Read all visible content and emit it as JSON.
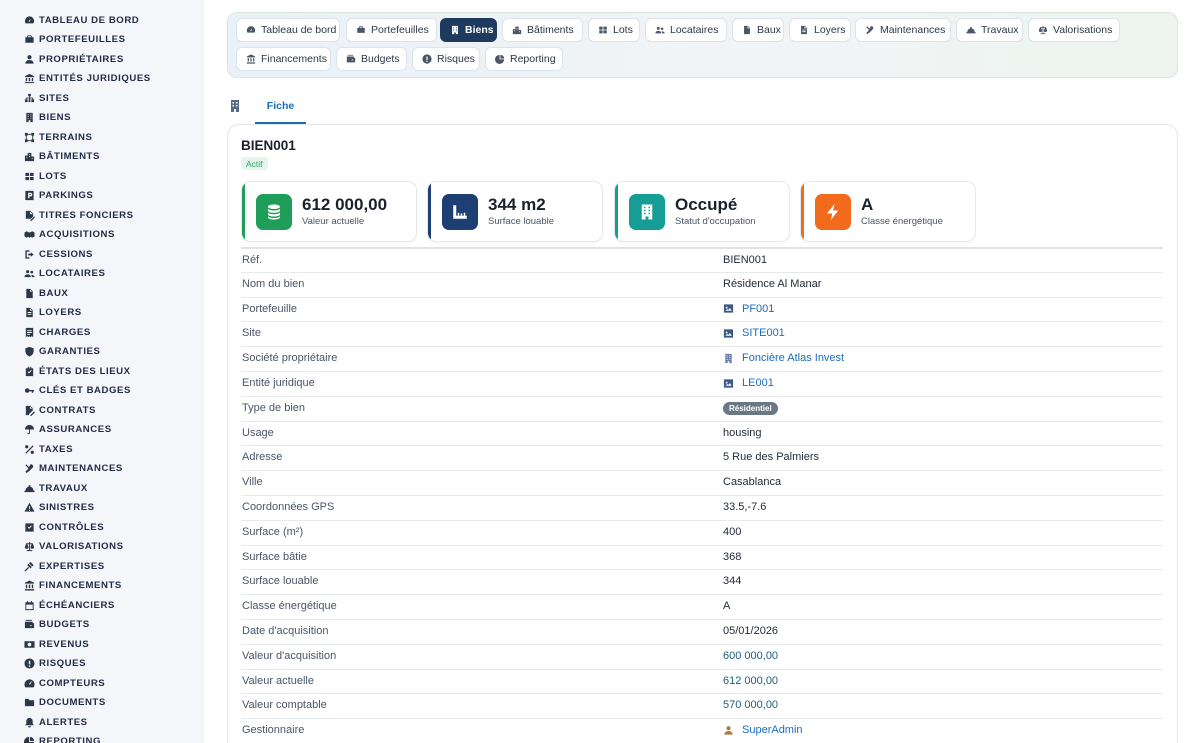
{
  "sidebar": {
    "items": [
      {
        "label": "TABLEAU DE BORD",
        "icon": "dashboard-icon"
      },
      {
        "label": "PORTEFEUILLES",
        "icon": "briefcase-icon"
      },
      {
        "label": "PROPRIÉTAIRES",
        "icon": "user-icon"
      },
      {
        "label": "ENTITÉS JURIDIQUES",
        "icon": "bank-icon"
      },
      {
        "label": "SITES",
        "icon": "sitemap-icon"
      },
      {
        "label": "BIENS",
        "icon": "building-icon"
      },
      {
        "label": "TERRAINS",
        "icon": "vector-square-icon"
      },
      {
        "label": "BÂTIMENTS",
        "icon": "city-icon"
      },
      {
        "label": "LOTS",
        "icon": "grid-icon"
      },
      {
        "label": "PARKINGS",
        "icon": "parking-icon"
      },
      {
        "label": "TITRES FONCIERS",
        "icon": "file-signature-icon"
      },
      {
        "label": "ACQUISITIONS",
        "icon": "handshake-icon"
      },
      {
        "label": "CESSIONS",
        "icon": "sign-out-icon"
      },
      {
        "label": "LOCATAIRES",
        "icon": "users-icon"
      },
      {
        "label": "BAUX",
        "icon": "file-contract-icon"
      },
      {
        "label": "LOYERS",
        "icon": "file-invoice-icon"
      },
      {
        "label": "CHARGES",
        "icon": "receipt-icon"
      },
      {
        "label": "GARANTIES",
        "icon": "shield-icon"
      },
      {
        "label": "ÉTATS DES LIEUX",
        "icon": "clipboard-check-icon"
      },
      {
        "label": "CLÉS ET BADGES",
        "icon": "key-icon"
      },
      {
        "label": "CONTRATS",
        "icon": "file-pen-icon"
      },
      {
        "label": "ASSURANCES",
        "icon": "umbrella-icon"
      },
      {
        "label": "TAXES",
        "icon": "percent-icon"
      },
      {
        "label": "MAINTENANCES",
        "icon": "tools-icon"
      },
      {
        "label": "TRAVAUX",
        "icon": "hard-hat-icon"
      },
      {
        "label": "SINISTRES",
        "icon": "warning-icon"
      },
      {
        "label": "CONTRÔLES",
        "icon": "check-square-icon"
      },
      {
        "label": "VALORISATIONS",
        "icon": "balance-scale-icon"
      },
      {
        "label": "EXPERTISES",
        "icon": "gavel-icon"
      },
      {
        "label": "FINANCEMENTS",
        "icon": "landmark-icon"
      },
      {
        "label": "ÉCHÉANCIERS",
        "icon": "calendar-icon"
      },
      {
        "label": "BUDGETS",
        "icon": "wallet-icon"
      },
      {
        "label": "REVENUS",
        "icon": "money-bill-icon"
      },
      {
        "label": "RISQUES",
        "icon": "exclamation-circle-icon"
      },
      {
        "label": "COMPTEURS",
        "icon": "gauge-icon"
      },
      {
        "label": "DOCUMENTS",
        "icon": "folder-icon"
      },
      {
        "label": "ALERTES",
        "icon": "bell-icon"
      },
      {
        "label": "REPORTING",
        "icon": "chart-pie-icon"
      }
    ]
  },
  "top_tabs": [
    {
      "label": "Tableau de bord",
      "icon": "dashboard-icon"
    },
    {
      "label": "Portefeuilles",
      "icon": "briefcase-icon"
    },
    {
      "label": "Biens",
      "icon": "building-icon",
      "active": true
    },
    {
      "label": "Bâtiments",
      "icon": "city-icon"
    },
    {
      "label": "Lots",
      "icon": "grid-icon"
    },
    {
      "label": "Locataires",
      "icon": "users-icon"
    },
    {
      "label": "Baux",
      "icon": "file-contract-icon"
    },
    {
      "label": "Loyers",
      "icon": "file-invoice-icon"
    },
    {
      "label": "Maintenances",
      "icon": "tools-icon"
    },
    {
      "label": "Travaux",
      "icon": "hard-hat-icon"
    },
    {
      "label": "Valorisations",
      "icon": "balance-scale-icon"
    },
    {
      "label": "Financements",
      "icon": "landmark-icon"
    },
    {
      "label": "Budgets",
      "icon": "wallet-icon"
    },
    {
      "label": "Risques",
      "icon": "exclamation-circle-icon"
    },
    {
      "label": "Reporting",
      "icon": "chart-pie-icon"
    }
  ],
  "sub_tabs": {
    "active_label": "Fiche",
    "icon": "building-icon"
  },
  "record": {
    "title": "BIEN001",
    "status": "Actif"
  },
  "kpis": [
    {
      "value": "612 000,00",
      "label": "Valeur actuelle",
      "icon": "coins-icon",
      "color": "#1e9e59"
    },
    {
      "value": "344 m2",
      "label": "Surface louable",
      "icon": "ruler-icon",
      "color": "#1e3f73"
    },
    {
      "value": "Occupé",
      "label": "Statut d'occupation",
      "icon": "building-icon",
      "color": "#169e96"
    },
    {
      "value": "A",
      "label": "Classe énergétique",
      "icon": "bolt-icon",
      "color": "#f26b1d"
    }
  ],
  "details": [
    {
      "label": "Réf.",
      "value": "BIEN001"
    },
    {
      "label": "Nom du bien",
      "value": "Résidence Al Manar"
    },
    {
      "label": "Portefeuille",
      "value": "PF001",
      "link": true,
      "icon": "image-icon"
    },
    {
      "label": "Site",
      "value": "SITE001",
      "link": true,
      "icon": "image-icon"
    },
    {
      "label": "Société propriétaire",
      "value": "Foncière Atlas Invest",
      "link": true,
      "icon": "building-icon"
    },
    {
      "label": "Entité juridique",
      "value": "LE001",
      "link": true,
      "icon": "image-icon"
    },
    {
      "label": "Type de bien",
      "value": "Résidentiel",
      "pill": true
    },
    {
      "label": "Usage",
      "value": "housing"
    },
    {
      "label": "Adresse",
      "value": "5 Rue des Palmiers"
    },
    {
      "label": "Ville",
      "value": "Casablanca"
    },
    {
      "label": "Coordonnées GPS",
      "value": "33.5,-7.6"
    },
    {
      "label": "Surface (m²)",
      "value": "400"
    },
    {
      "label": "Surface bâtie",
      "value": "368"
    },
    {
      "label": "Surface louable",
      "value": "344"
    },
    {
      "label": "Classe énergétique",
      "value": "A"
    },
    {
      "label": "Date d'acquisition",
      "value": "05/01/2026"
    },
    {
      "label": "Valeur d'acquisition",
      "value": "600 000,00",
      "money": true
    },
    {
      "label": "Valeur actuelle",
      "value": "612 000,00",
      "money": true
    },
    {
      "label": "Valeur comptable",
      "value": "570 000,00",
      "money": true
    },
    {
      "label": "Gestionnaire",
      "value": "SuperAdmin",
      "link": true,
      "icon": "user-icon"
    }
  ],
  "colors": {
    "active_tab": "#1e3a5f",
    "link": "#1a6dbd",
    "money": "#1b5f7a",
    "status_green": "#2fa36b"
  }
}
